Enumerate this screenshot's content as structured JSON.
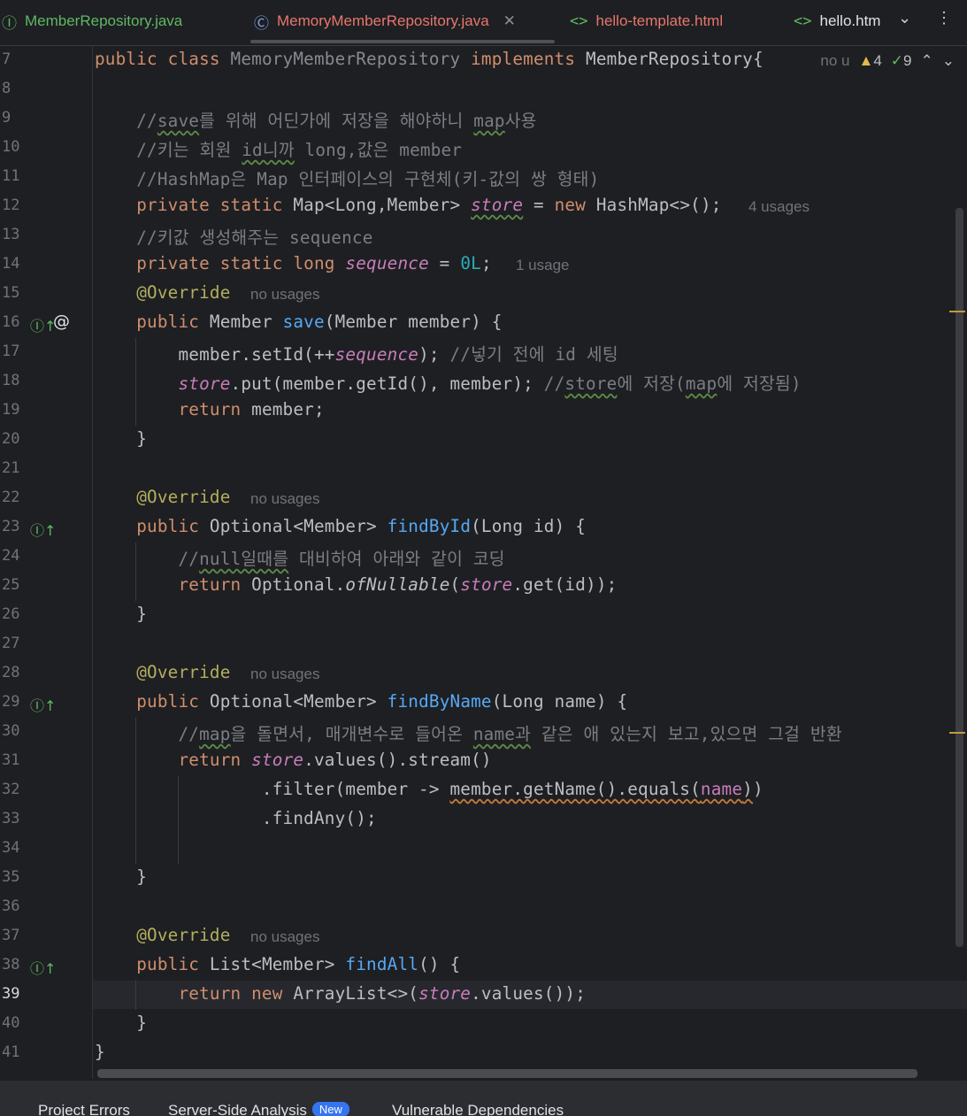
{
  "tabs": [
    {
      "icon": "I",
      "label": "MemberRepository.java",
      "color": "#5fb865"
    },
    {
      "icon": "C",
      "label": "MemoryMemberRepository.java",
      "color": "#e8766d",
      "active": true
    },
    {
      "icon": "<>",
      "label": "hello-template.html",
      "color": "#e8766d"
    },
    {
      "icon": "<>",
      "label": "hello.htm",
      "color": "#dfe1e5"
    }
  ],
  "status": {
    "hint": "no u",
    "warnings": "4",
    "weak_warnings": "9"
  },
  "lines": [
    {
      "n": "7",
      "html": "<span class='kw'>public class</span> <span class='dim'>MemoryMemberRepository</span> <span class='kw'>implements</span> MemberRepository{"
    },
    {
      "n": "8",
      "html": ""
    },
    {
      "n": "9",
      "html": "    <span class='cmt'>//<span class='wavy'>save</span>를 위해 어딘가에 저장을 해야하니 <span class='wavy'>map</span>사용</span>"
    },
    {
      "n": "10",
      "html": "    <span class='cmt'>//키는 회원 <span class='wavy'>id니까</span> long,값은 member</span>"
    },
    {
      "n": "11",
      "html": "    <span class='cmt'>//HashMap은 Map 인터페이스의 구현체(키-값의 쌍 형태)</span>"
    },
    {
      "n": "12",
      "html": "    <span class='kw'>private static</span> Map&lt;Long,Member&gt; <span class='fld wavy'>store</span> = <span class='kw'>new</span> HashMap&lt;&gt;();",
      "hint": "4 usages"
    },
    {
      "n": "13",
      "html": "    <span class='cmt'>//키값 생성해주는 sequence</span>"
    },
    {
      "n": "14",
      "html": "    <span class='kw'>private static long</span> <span class='fld'>sequence</span> = <span class='num'>0L</span>;",
      "hint": "1 usage"
    },
    {
      "n": "15",
      "html": "    <span class='ann'>@Override</span>",
      "hint": "no usages"
    },
    {
      "n": "16",
      "html": "    <span class='kw'>public</span> Member <span class='fn'>save</span>(Member member) {",
      "icon": "impl",
      "at": true
    },
    {
      "n": "17",
      "html": "        member.setId(++<span class='fld'>sequence</span>); <span class='cmt'>//넣기 전에 id 세팅</span>"
    },
    {
      "n": "18",
      "html": "        <span class='fld'>store</span>.put(member.getId(), member); <span class='cmt'>//<span class='wavy'>store</span>에 저장(<span class='wavy'>map</span>에 저장됨)</span>"
    },
    {
      "n": "19",
      "html": "        <span class='kw'>return</span> member;"
    },
    {
      "n": "20",
      "html": "    }"
    },
    {
      "n": "21",
      "html": ""
    },
    {
      "n": "22",
      "html": "    <span class='ann'>@Override</span>",
      "hint": "no usages"
    },
    {
      "n": "23",
      "html": "    <span class='kw'>public</span> Optional&lt;Member&gt; <span class='fn'>findById</span>(Long id) {",
      "icon": "impl"
    },
    {
      "n": "24",
      "html": "        <span class='cmt'>//<span class='wavy'>null일때를</span> 대비하여 아래와 같이 코딩</span>"
    },
    {
      "n": "25",
      "html": "        <span class='kw'>return</span> Optional.<span class='stat'>ofNullable</span>(<span class='fld'>store</span>.get(id));"
    },
    {
      "n": "26",
      "html": "    }"
    },
    {
      "n": "27",
      "html": ""
    },
    {
      "n": "28",
      "html": "    <span class='ann'>@Override</span>",
      "hint": "no usages"
    },
    {
      "n": "29",
      "html": "    <span class='kw'>public</span> Optional&lt;Member&gt; <span class='fn'>findByName</span>(Long name) {",
      "icon": "impl"
    },
    {
      "n": "30",
      "html": "        <span class='cmt'>//<span class='wavy'>map</span>을 돌면서, 매개변수로 들어온 <span class='wavy'>name과</span> 같은 애 있는지 보고,있으면 그걸 반환</span>"
    },
    {
      "n": "31",
      "html": "        <span class='kw'>return</span> <span class='fld'>store</span>.values().stream()"
    },
    {
      "n": "32",
      "html": "                .filter(member -&gt; <span class='wavyr'>member.getName().equals(<span class='fld' style='font-style:normal'>name</span>)</span>)"
    },
    {
      "n": "33",
      "html": "                .findAny();"
    },
    {
      "n": "34",
      "html": ""
    },
    {
      "n": "35",
      "html": "    }"
    },
    {
      "n": "36",
      "html": ""
    },
    {
      "n": "37",
      "html": "    <span class='ann'>@Override</span>",
      "hint": "no usages"
    },
    {
      "n": "38",
      "html": "    <span class='kw'>public</span> List&lt;Member&gt; <span class='fn'>findAll</span>() {",
      "icon": "impl"
    },
    {
      "n": "39",
      "html": "        <span class='kw'>return new</span> ArrayList&lt;&gt;(<span class='fld'>store</span>.values());",
      "current": true
    },
    {
      "n": "40",
      "html": "    }"
    },
    {
      "n": "41",
      "html": "}"
    }
  ],
  "bottom_tabs": [
    {
      "label": "Project Errors"
    },
    {
      "label": "Server-Side Analysis",
      "badge": "New"
    },
    {
      "label": "Vulnerable Dependencies"
    }
  ]
}
